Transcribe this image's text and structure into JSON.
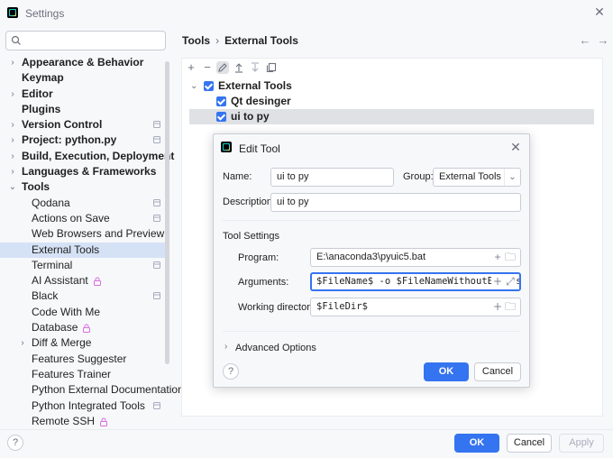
{
  "window": {
    "title": "Settings"
  },
  "search": {
    "placeholder": ""
  },
  "sidebar": {
    "items": [
      {
        "label": "Appearance & Behavior",
        "bold": true,
        "chevron": "right",
        "indent": 0
      },
      {
        "label": "Keymap",
        "bold": true,
        "chevron": "",
        "indent": 0
      },
      {
        "label": "Editor",
        "bold": true,
        "chevron": "right",
        "indent": 0
      },
      {
        "label": "Plugins",
        "bold": true,
        "chevron": "",
        "indent": 0
      },
      {
        "label": "Version Control",
        "bold": true,
        "chevron": "right",
        "indent": 0,
        "badge": "project"
      },
      {
        "label": "Project: python.py",
        "bold": true,
        "chevron": "right",
        "indent": 0,
        "badge": "project"
      },
      {
        "label": "Build, Execution, Deployment",
        "bold": true,
        "chevron": "right",
        "indent": 0
      },
      {
        "label": "Languages & Frameworks",
        "bold": true,
        "chevron": "right",
        "indent": 0
      },
      {
        "label": "Tools",
        "bold": true,
        "chevron": "down",
        "indent": 0
      },
      {
        "label": "Qodana",
        "indent": 1,
        "badge": "project"
      },
      {
        "label": "Actions on Save",
        "indent": 1,
        "badge": "project"
      },
      {
        "label": "Web Browsers and Preview",
        "indent": 1
      },
      {
        "label": "External Tools",
        "indent": 1,
        "selected": true
      },
      {
        "label": "Terminal",
        "indent": 1,
        "badge": "project"
      },
      {
        "label": "AI Assistant",
        "indent": 1,
        "lock": true
      },
      {
        "label": "Black",
        "indent": 1,
        "badge": "project"
      },
      {
        "label": "Code With Me",
        "indent": 1
      },
      {
        "label": "Database",
        "indent": 1,
        "lock": true
      },
      {
        "label": "Diff & Merge",
        "indent": 1,
        "chevron": "right"
      },
      {
        "label": "Features Suggester",
        "indent": 1
      },
      {
        "label": "Features Trainer",
        "indent": 1
      },
      {
        "label": "Python External Documentation",
        "indent": 1
      },
      {
        "label": "Python Integrated Tools",
        "indent": 1,
        "badge": "project"
      },
      {
        "label": "Remote SSH",
        "indent": 1,
        "lock": true
      }
    ]
  },
  "breadcrumb": {
    "parent": "Tools",
    "separator": "›",
    "current": "External Tools"
  },
  "tools": {
    "group": "External Tools",
    "items": [
      "Qt desinger",
      "ui to py"
    ]
  },
  "dialog": {
    "title": "Edit Tool",
    "name_label": "Name:",
    "name_value": "ui to py",
    "group_label": "Group:",
    "group_value": "External Tools",
    "description_label": "Description:",
    "description_value": "ui to py",
    "section_label": "Tool Settings",
    "program_label": "Program:",
    "program_value": "E:\\anaconda3\\pyuic5.bat",
    "arguments_label": "Arguments:",
    "arguments_value": "$FileName$ -o $FileNameWithoutExtension",
    "workdir_label": "Working directory:",
    "workdir_value": "$FileDir$",
    "advanced_label": "Advanced Options",
    "help_label": "?",
    "ok_label": "OK",
    "cancel_label": "Cancel"
  },
  "footer": {
    "help_label": "?",
    "ok_label": "OK",
    "cancel_label": "Cancel",
    "apply_label": "Apply"
  },
  "colors": {
    "accent": "#3574f0",
    "selection": "#d5e1f5",
    "background": "#f7f8fa"
  }
}
